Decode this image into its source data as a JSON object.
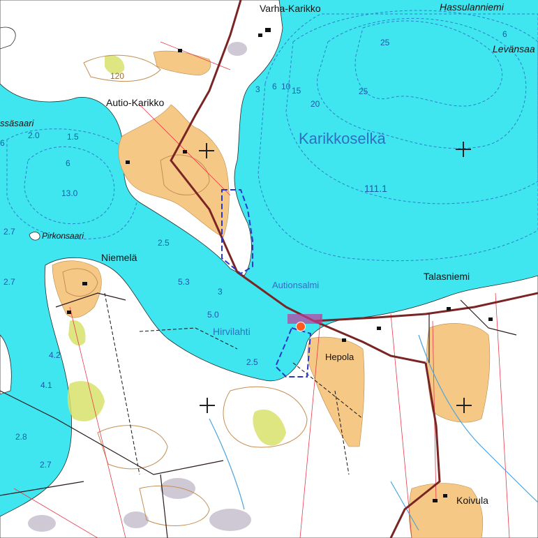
{
  "map": {
    "colors": {
      "water": "#3fe6f0",
      "land": "#ffffff",
      "field": "#f6c886",
      "road": "#7a2424",
      "contour": "#c58e52",
      "property_line": "#e8394b",
      "protected_area": "#2a36c8",
      "marker": "#ff5a1f",
      "crossing": "#c23a9a",
      "marsh": "#c9d64a"
    },
    "place_names": {
      "varha_karikko": "Varha-Karikko",
      "hassulanniemi": "Hassulanniemi",
      "levansaa": "Levänsaa",
      "autio_karikko": "Autio-Karikko",
      "lassasaari": "ssäsaari",
      "pirkonsaari": "Pirkonsaari",
      "niemela": "Niemelä",
      "autionsalmi": "Autionsalmi",
      "talasniemi": "Talasniemi",
      "hirvilahti": "Hirvilahti",
      "hepola": "Hepola",
      "koivula": "Koivula"
    },
    "water_body": {
      "name": "Karikkoselkä",
      "water_level": "111.1"
    },
    "depths": {
      "d25_top": "25",
      "d25_mid": "25",
      "d20": "20",
      "d15": "15",
      "d10": "10",
      "d6_right": "6",
      "d6_mid": "6",
      "d3": "3",
      "d2_0": "2.0",
      "d1_5": "1.5",
      "d6_left": "6",
      "d13_0": "13.0",
      "d2_7a": "2.7",
      "d2_5a": "2.5",
      "d2_7b": "2.7",
      "d5_3": "5.3",
      "d3b": "3",
      "d5_0": "5.0",
      "d4_2": "4.2",
      "d2_5b": "2.5",
      "d4_1": "4.1",
      "d2_8": "2.8",
      "d2_7c": "2.7",
      "d6_edge": "6"
    },
    "contours": {
      "c120": "120"
    },
    "marker": {
      "name": "location marker"
    }
  }
}
